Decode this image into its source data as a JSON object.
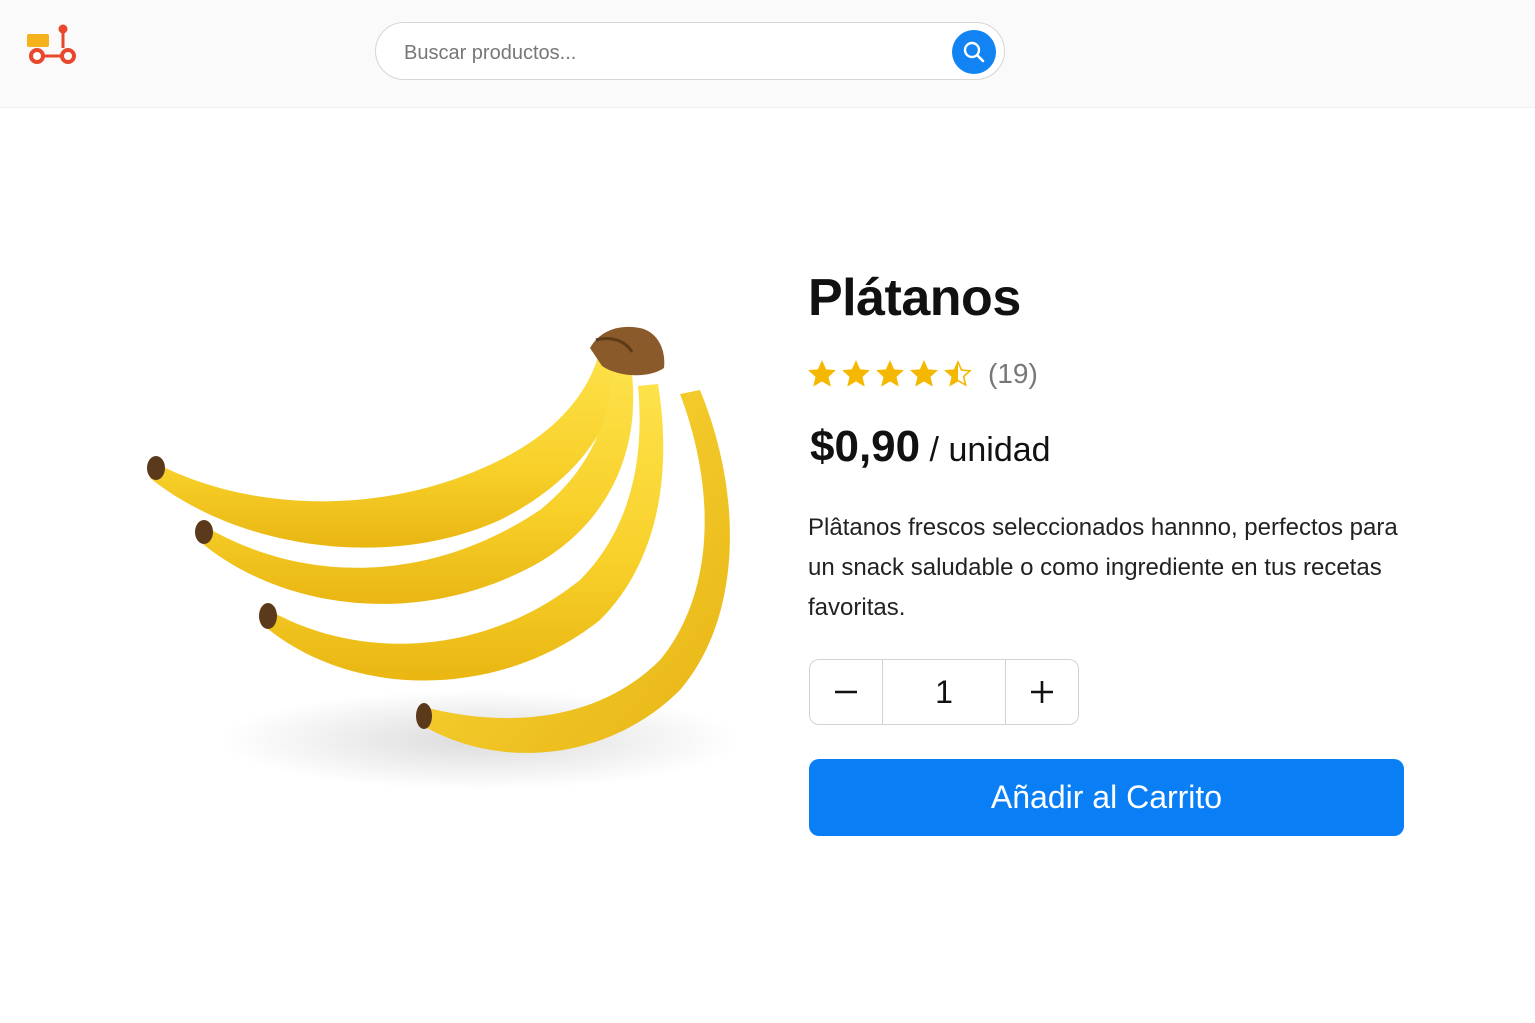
{
  "header": {
    "logo_icon": "delivery-scooter-logo-icon",
    "search": {
      "placeholder": "Buscar productos...",
      "value": "",
      "button_icon": "search-icon",
      "button_color": "#1283f2"
    }
  },
  "product": {
    "image_icon": "banana-bunch-image",
    "title": "Plátanos",
    "rating": {
      "value": 4.5,
      "max": 5,
      "count_text": "(19)",
      "star_color": "#f5b800"
    },
    "price": {
      "amount": "$0,90",
      "unit": " / unidad"
    },
    "description": "Plâtanos frescos seleccionados  hannno, perfectos para un snack saludable o como ingrediente en tus recetas favoritas.",
    "quantity": {
      "value": "1",
      "decrement_icon": "minus-icon",
      "increment_icon": "plus-icon"
    },
    "add_to_cart_label": "Añadir al Carrito",
    "add_to_cart_color": "#0a7ff5"
  }
}
